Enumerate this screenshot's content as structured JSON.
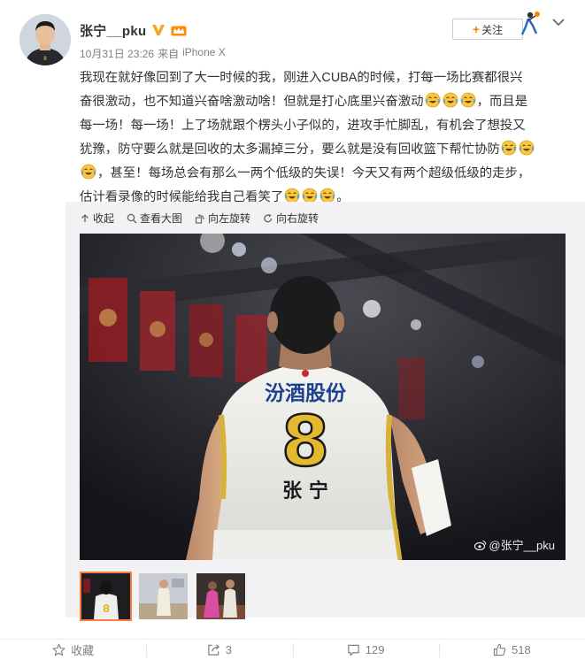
{
  "post": {
    "username": "张宁__pku",
    "date": "10月31日 23:26",
    "source_prefix": "来自",
    "source": "iPhone X",
    "text_lines": [
      "我现在就好像回到了大一时候的我，刚进入CUBA的时候，打每一场比赛都很兴",
      "奋很激动，也不知道兴奋啥激动啥！但就是打心底里兴奋激动",
      "，而且是",
      "每一场！每一场！上了场就跟个楞头小子似的，进攻手忙脚乱，有机会了想投又",
      "犹豫，防守要么就是回收的太多漏掉三分，要么就是没有回收篮下帮忙协防",
      "，甚至！每场总会有那么一两个低级的失误！今天又有两个超级低级的走步，",
      "估计看录像的时候能给我自己看笑了",
      "。"
    ],
    "emoji_icon": "laugh-cry-emoji"
  },
  "follow": {
    "label": "关注",
    "plus": "+"
  },
  "media_toolbar": {
    "collapse": "收起",
    "view_large": "查看大图",
    "rotate_left": "向左旋转",
    "rotate_right": "向右旋转"
  },
  "photo": {
    "watermark": "@张宁__pku",
    "jersey_sponsor": "汾酒股份",
    "jersey_number": "8",
    "jersey_name": "张 宁"
  },
  "actions": {
    "favorite": "收藏",
    "repost": "3",
    "comment": "129",
    "like": "518"
  },
  "colors": {
    "accent": "#ff8200",
    "thumb_active": "#fa7d3c",
    "media_bg": "#f2f2f5"
  }
}
